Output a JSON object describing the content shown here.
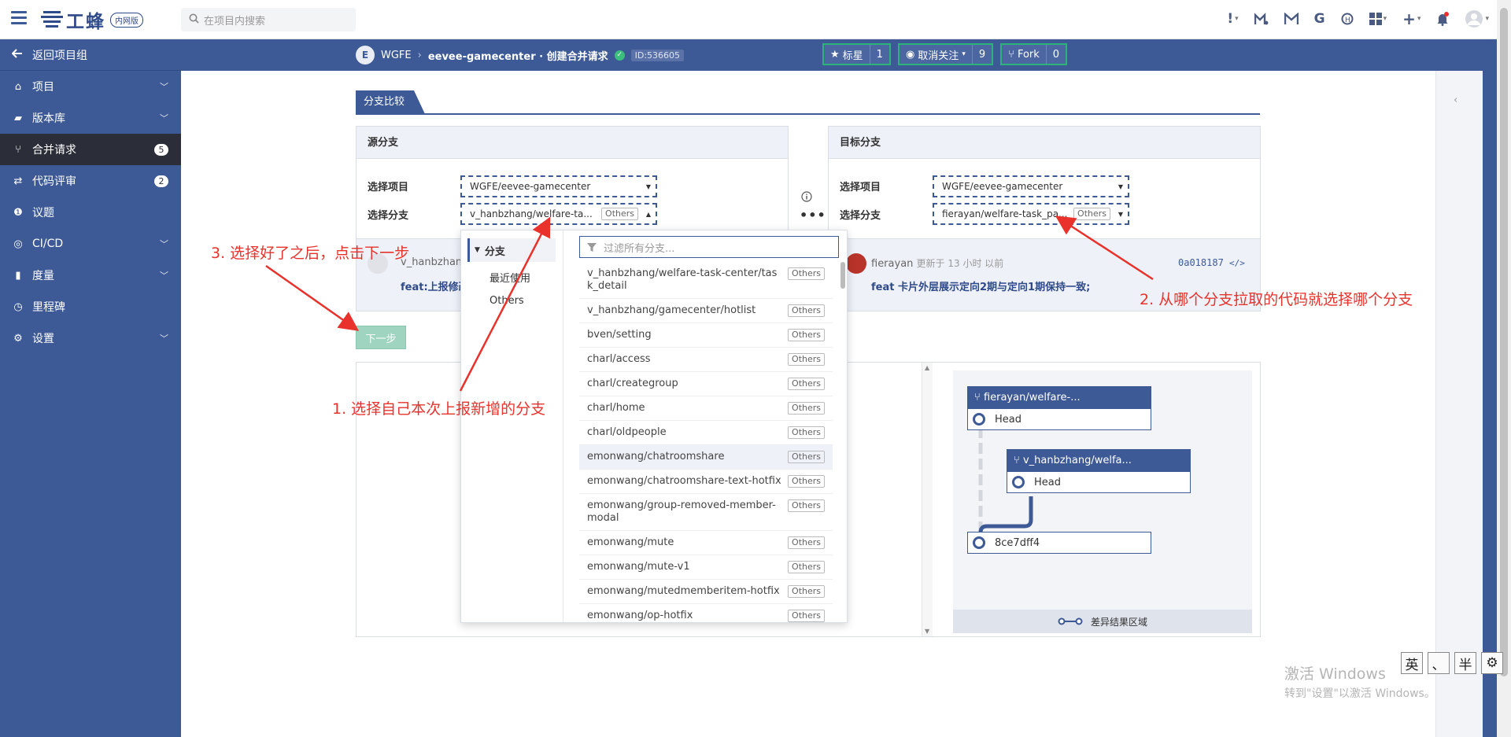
{
  "topbar": {
    "logo_text": "工蜂",
    "logo_tag": "内网版",
    "search_placeholder": "在项目内搜索",
    "icons": [
      "alert-icon",
      "merge-icon",
      "mail-icon",
      "g-icon",
      "help-icon",
      "apps-icon",
      "plus-icon",
      "bell-icon",
      "user-avatar-icon"
    ]
  },
  "sidebar": {
    "back_label": "返回项目组",
    "items": [
      {
        "label": "项目",
        "icon": "home-icon",
        "chevron": true
      },
      {
        "label": "版本库",
        "icon": "folder-icon",
        "chevron": true
      },
      {
        "label": "合并请求",
        "icon": "merge-request-icon",
        "badge": "5",
        "active": true
      },
      {
        "label": "代码评审",
        "icon": "code-review-icon",
        "badge": "2"
      },
      {
        "label": "议题",
        "icon": "issue-icon"
      },
      {
        "label": "CI/CD",
        "icon": "cicd-icon",
        "chevron": true
      },
      {
        "label": "度量",
        "icon": "chart-icon",
        "chevron": true
      },
      {
        "label": "里程碑",
        "icon": "milestone-icon"
      },
      {
        "label": "设置",
        "icon": "settings-icon",
        "chevron": true
      }
    ]
  },
  "header": {
    "project_initial": "E",
    "group": "WGFE",
    "title": "eevee-gamecenter · 创建合并请求",
    "id_tag": "ID:536605",
    "star_label": "标星",
    "star_count": "1",
    "watch_label": "取消关注",
    "watch_count": "9",
    "fork_label": "Fork",
    "fork_count": "0"
  },
  "page": {
    "tab_title": "分支比较",
    "next_button": "下一步"
  },
  "source": {
    "header": "源分支",
    "project_label": "选择项目",
    "project_value": "WGFE/eevee-gamecenter",
    "branch_label": "选择分支",
    "branch_value": "v_hanbzhang/welfare-ta...",
    "branch_tag": "Others",
    "commit_author": "v_hanbzhang",
    "commit_msg": "feat:上报修改"
  },
  "target": {
    "header": "目标分支",
    "project_label": "选择项目",
    "project_value": "WGFE/eevee-gamecenter",
    "branch_label": "选择分支",
    "branch_value": "fierayan/welfare-task_pa...",
    "branch_tag": "Others",
    "commit_author": "fierayan",
    "commit_time": "更新于 13 小时 以前",
    "commit_hash": "0a018187",
    "commit_msg": "feat 卡片外层展示定向2期与定向1期保持一致;"
  },
  "dropdown": {
    "group_label": "分支",
    "options": [
      "最近使用",
      "Others"
    ],
    "filter_placeholder": "过滤所有分支...",
    "items": [
      {
        "name": "v_hanbzhang/welfare-task-center/task_detail",
        "tag": "Others"
      },
      {
        "name": "v_hanbzhang/gamecenter/hotlist",
        "tag": "Others"
      },
      {
        "name": "bven/setting",
        "tag": "Others"
      },
      {
        "name": "charl/access",
        "tag": "Others"
      },
      {
        "name": "charl/creategroup",
        "tag": "Others"
      },
      {
        "name": "charl/home",
        "tag": "Others"
      },
      {
        "name": "charl/oldpeople",
        "tag": "Others"
      },
      {
        "name": "emonwang/chatroomshare",
        "tag": "Others"
      },
      {
        "name": "emonwang/chatroomshare-text-hotfix",
        "tag": "Others"
      },
      {
        "name": "emonwang/group-removed-member-modal",
        "tag": "Others"
      },
      {
        "name": "emonwang/mute",
        "tag": "Others"
      },
      {
        "name": "emonwang/mute-v1",
        "tag": "Others"
      },
      {
        "name": "emonwang/mutedmemberitem-hotfix",
        "tag": "Others"
      },
      {
        "name": "emonwang/op-hotfix",
        "tag": "Others"
      }
    ]
  },
  "graph": {
    "target_branch": "fierayan/welfare-...",
    "target_row": "Head",
    "source_branch": "v_hanbzhang/welfa...",
    "source_row": "Head",
    "base_commit": "8ce7dff4",
    "footer": "差异结果区域"
  },
  "annotations": {
    "step1": "1. 选择自己本次上报新增的分支",
    "step2": "2. 从哪个分支拉取的代码就选择哪个分支",
    "step3": "3. 选择好了之后，点击下一步"
  },
  "watermark": {
    "line1": "激活 Windows",
    "line2": "转到\"设置\"以激活 Windows。"
  },
  "ime": [
    "英",
    "、",
    "半",
    "⚙"
  ],
  "colors": {
    "primary": "#3d5a96",
    "sidebar_active": "#2b2e38",
    "annotation": "#e8322b",
    "button_green": "#9fd4c0"
  }
}
